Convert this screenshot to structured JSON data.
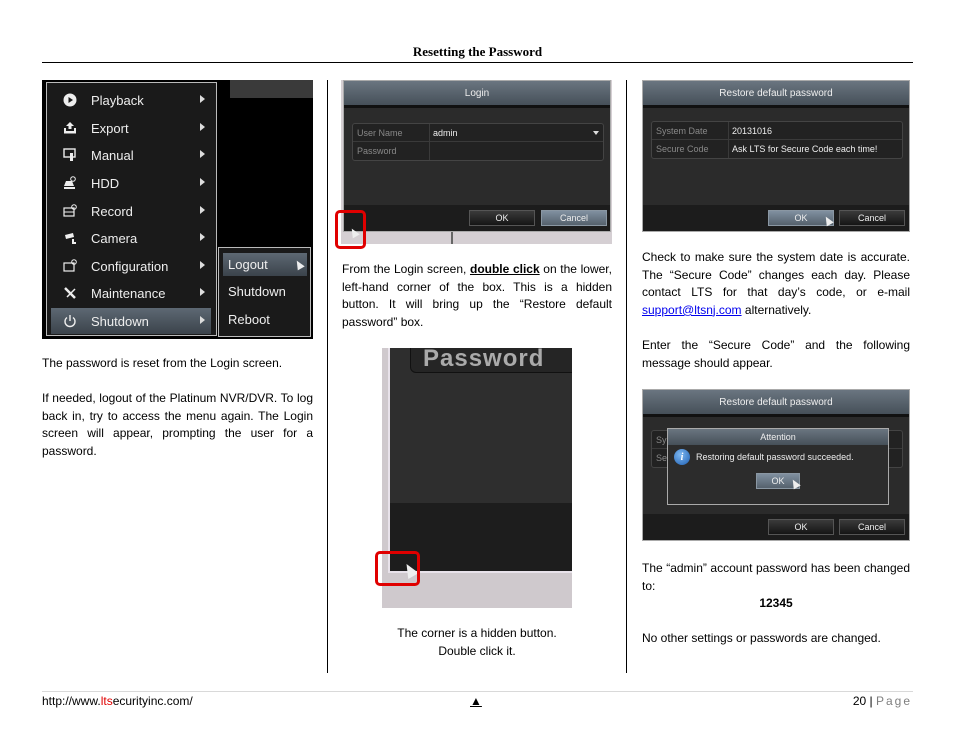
{
  "header": {
    "title": "Resetting the Password"
  },
  "column1": {
    "menu": {
      "items": [
        {
          "label": "Playback",
          "icon": "play-circle-icon"
        },
        {
          "label": "Export",
          "icon": "export-upload-icon"
        },
        {
          "label": "Manual",
          "icon": "manual-icon"
        },
        {
          "label": "HDD",
          "icon": "hdd-icon"
        },
        {
          "label": "Record",
          "icon": "record-icon"
        },
        {
          "label": "Camera",
          "icon": "camera-icon"
        },
        {
          "label": "Configuration",
          "icon": "configuration-icon"
        },
        {
          "label": "Maintenance",
          "icon": "maintenance-icon"
        },
        {
          "label": "Shutdown",
          "icon": "power-icon",
          "active": true
        }
      ],
      "submenu": [
        {
          "label": "Logout",
          "active": true
        },
        {
          "label": "Shutdown"
        },
        {
          "label": "Reboot"
        }
      ]
    },
    "para1": "The password is reset from the Login screen.",
    "para2": "If needed, logout of the Platinum NVR/DVR. To log back in, try to access the menu again. The Login screen will appear, prompting the user for a password."
  },
  "column2": {
    "login_dialog": {
      "title": "Login",
      "fields": [
        {
          "label": "User Name",
          "value": "admin"
        },
        {
          "label": "Password",
          "value": ""
        }
      ],
      "ok_label": "OK",
      "cancel_label": "Cancel"
    },
    "para_pre": "From the Login screen, ",
    "para_emph": "double click",
    "para_post": " on the lower, left-hand corner of the box.  This is a hidden button.  It will bring up the “Restore default password” box.",
    "corner_zoom_label": "Password",
    "caption_line1": "The corner is a hidden button.",
    "caption_line2": "Double click it."
  },
  "column3": {
    "restore_dialog": {
      "title": "Restore default password",
      "fields": [
        {
          "label": "System Date",
          "value": "20131016"
        },
        {
          "label": "Secure Code",
          "value": "Ask LTS for Secure Code each time!"
        }
      ],
      "ok_label": "OK",
      "cancel_label": "Cancel"
    },
    "para1_pre": "Check to make sure the system date is accurate.  The “Secure Code” changes each day.  Please contact LTS for that day’s code, or e-mail ",
    "para1_link": "support@ltsnj.com",
    "para1_post": " alternatively.",
    "para2": "Enter the “Secure Code” and the following message should appear.",
    "attention_dialog": {
      "outer_title": "Restore default password",
      "partial_labels": [
        "Sy",
        "Se"
      ],
      "title": "Attention",
      "message": "Restoring default password succeeded.",
      "ok_label": "OK",
      "outer_ok_label": "OK",
      "outer_cancel_label": "Cancel"
    },
    "para3": "The “admin” account password has been changed to:",
    "new_password": "12345",
    "para4": "No other settings or passwords are changed."
  },
  "footer": {
    "url_prefix": "http://www.",
    "url_highlight": "lts",
    "url_suffix": "ecurityinc.com/",
    "arrow": "▲",
    "page_number": "20",
    "page_sep": " | ",
    "page_word": "Page"
  }
}
